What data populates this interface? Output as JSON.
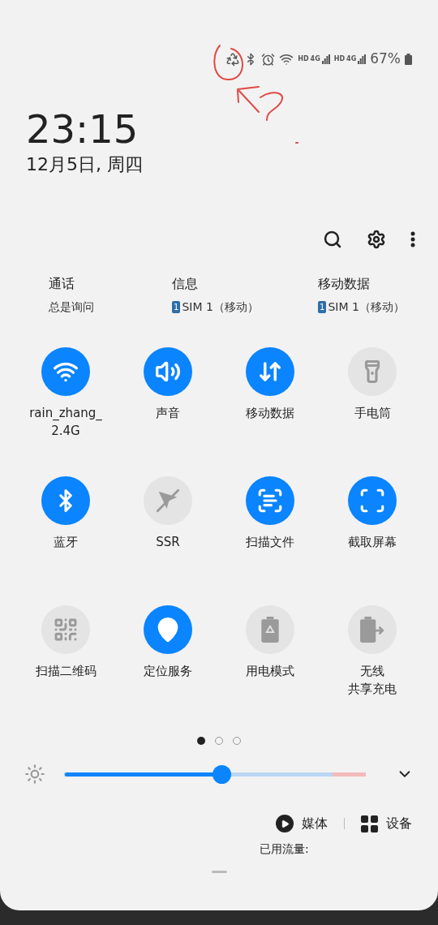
{
  "status_bar": {
    "network": [
      {
        "hd": "HD",
        "gen": "4G"
      },
      {
        "hd": "HD",
        "gen": "4G"
      }
    ],
    "battery": "67%"
  },
  "clock": {
    "time": "23:15",
    "date": "12月5日, 周四"
  },
  "sim_settings": [
    {
      "title": "通话",
      "value": "总是询问"
    },
    {
      "title": "信息",
      "sim_badge": "1",
      "value": "SIM 1（移动）"
    },
    {
      "title": "移动数据",
      "sim_badge": "1",
      "value": "SIM 1（移动）"
    }
  ],
  "tiles": [
    {
      "label_lines": [
        "rain_zhang_",
        "2.4G"
      ],
      "on": true
    },
    {
      "label_lines": [
        "声音"
      ],
      "on": true
    },
    {
      "label_lines": [
        "移动数据"
      ],
      "on": true
    },
    {
      "label_lines": [
        "手电筒"
      ],
      "on": false
    },
    {
      "label_lines": [
        "蓝牙"
      ],
      "on": true
    },
    {
      "label_lines": [
        "SSR"
      ],
      "on": false
    },
    {
      "label_lines": [
        "扫描文件"
      ],
      "on": true
    },
    {
      "label_lines": [
        "截取屏幕"
      ],
      "on": true
    },
    {
      "label_lines": [
        "扫描二维码"
      ],
      "on": false
    },
    {
      "label_lines": [
        "定位服务"
      ],
      "on": true
    },
    {
      "label_lines": [
        "用电模式"
      ],
      "on": false
    },
    {
      "label_lines": [
        "无线",
        "共享充电"
      ],
      "on": false
    }
  ],
  "page_dots": [
    {
      "selected": true
    },
    {
      "selected": false
    },
    {
      "selected": false
    }
  ],
  "brightness": {
    "level": 0.52
  },
  "output_buttons": [
    {
      "kind": "media",
      "label": "媒体"
    },
    {
      "kind": "devices",
      "label": "设备"
    }
  ],
  "data_usage": "已用流量:"
}
